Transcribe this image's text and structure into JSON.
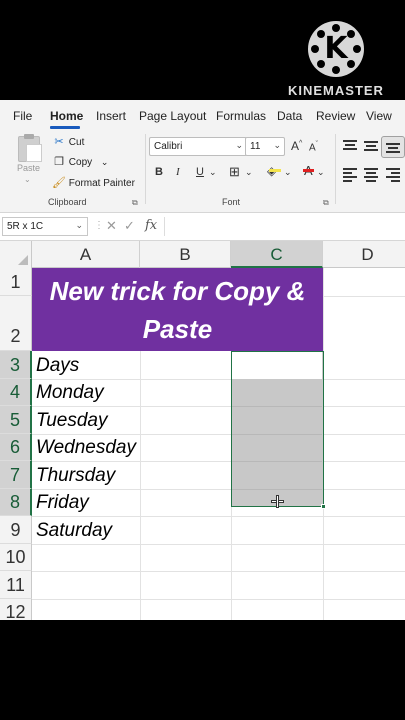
{
  "watermark": {
    "logo_letter": "K",
    "brand": "KINEMASTER"
  },
  "menu": {
    "items": [
      "File",
      "Home",
      "Insert",
      "Page Layout",
      "Formulas",
      "Data",
      "Review",
      "View"
    ],
    "active": "Home"
  },
  "clipboard": {
    "paste_label": "Paste",
    "cut_label": "Cut",
    "copy_label": "Copy",
    "format_painter_label": "Format Painter",
    "group_label": "Clipboard"
  },
  "font": {
    "family": "Calibri",
    "size": "11",
    "grow_label": "A",
    "shrink_label": "A",
    "bold": "B",
    "italic": "I",
    "underline": "U",
    "font_color_label": "A",
    "group_label": "Font"
  },
  "formula_bar": {
    "name_box": "5R x 1C",
    "cancel": "✕",
    "enter": "✓",
    "fx": "fx",
    "value": ""
  },
  "sheet": {
    "columns": [
      "A",
      "B",
      "C",
      "D"
    ],
    "selected_column": "C",
    "rows": [
      "1",
      "2",
      "3",
      "4",
      "5",
      "6",
      "7",
      "8",
      "9",
      "10",
      "11",
      "12"
    ],
    "selected_rows": [
      "3",
      "4",
      "5",
      "6",
      "7",
      "8"
    ],
    "title_line1": "New trick for Copy &",
    "title_line2": "Paste",
    "title_fill": "#7030a0",
    "days": [
      "Days",
      "Monday",
      "Tuesday",
      "Wednesday",
      "Thursday",
      "Friday",
      "Saturday"
    ],
    "selection_fill": "#c8c8c8",
    "accent": "#217346"
  }
}
